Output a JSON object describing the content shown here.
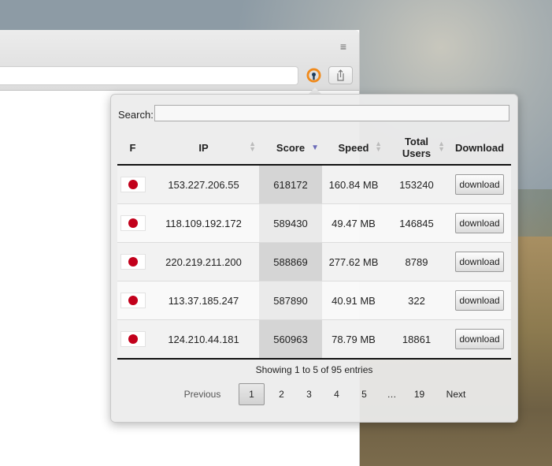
{
  "search": {
    "label": "Search:",
    "value": ""
  },
  "table": {
    "columns": [
      "F",
      "IP",
      "Score",
      "Speed",
      "Total Users",
      "Download"
    ],
    "rows": [
      {
        "flag": "japan-flag",
        "ip": "153.227.206.55",
        "score": "618172",
        "speed": "160.84 MB",
        "users": "153240",
        "action": "download"
      },
      {
        "flag": "japan-flag",
        "ip": "118.109.192.172",
        "score": "589430",
        "speed": "49.47 MB",
        "users": "146845",
        "action": "download"
      },
      {
        "flag": "japan-flag",
        "ip": "220.219.211.200",
        "score": "588869",
        "speed": "277.62 MB",
        "users": "8789",
        "action": "download"
      },
      {
        "flag": "japan-flag",
        "ip": "113.37.185.247",
        "score": "587890",
        "speed": "40.91 MB",
        "users": "322",
        "action": "download"
      },
      {
        "flag": "japan-flag",
        "ip": "124.210.44.181",
        "score": "560963",
        "speed": "78.79 MB",
        "users": "18861",
        "action": "download"
      }
    ]
  },
  "info": "Showing 1 to 5 of 95 entries",
  "pagination": {
    "previous": "Previous",
    "pages": [
      "1",
      "2",
      "3",
      "4",
      "5",
      "…",
      "19"
    ],
    "next": "Next"
  },
  "icons": {
    "menu": "menu-icon",
    "extension": "openvpn-icon",
    "share": "share-icon"
  },
  "colors": {
    "accent_sort": "#6b6bb8",
    "flag_red": "#c2001b"
  }
}
